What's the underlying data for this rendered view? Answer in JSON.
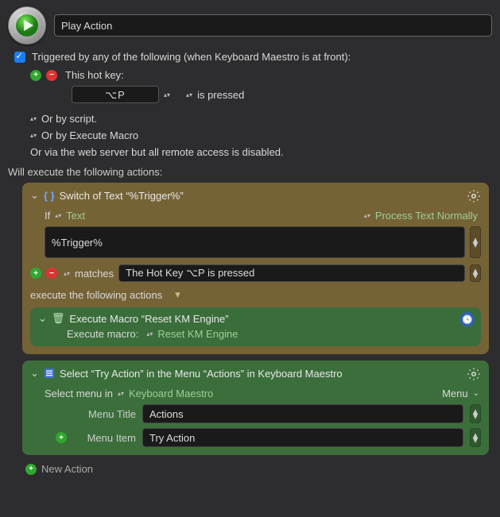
{
  "header": {
    "macro_name": "Play Action"
  },
  "trigger_section": {
    "checkbox_label": "Triggered by any of the following (when Keyboard Maestro is at front):",
    "hotkey_label": "This hot key:",
    "hotkey_value": "⌥P",
    "is_pressed_label": "is pressed",
    "or_script": "Or by script.",
    "or_exec_macro": "Or by Execute Macro",
    "or_webserver": "Or via the web server but all remote access is disabled."
  },
  "actions_heading": "Will execute the following actions:",
  "switch_panel": {
    "title": "Switch of Text “%Trigger%”",
    "if_label": "If",
    "text_label": "Text",
    "process_label": "Process Text Normally",
    "text_value": "%Trigger%",
    "matches_label": "matches",
    "match_value": "The Hot Key ⌥P is pressed",
    "execute_label": "execute the following actions",
    "nested": {
      "title": "Execute Macro “Reset KM Engine”",
      "exec_label": "Execute macro:",
      "macro_name": "Reset KM Engine"
    }
  },
  "select_panel": {
    "title": "Select “Try Action” in the Menu “Actions” in Keyboard Maestro",
    "select_menu_label": "Select menu in",
    "app_name": "Keyboard Maestro",
    "menu_popup_label": "Menu",
    "menu_title_label": "Menu Title",
    "menu_title_value": "Actions",
    "menu_item_label": "Menu Item",
    "menu_item_value": "Try Action"
  },
  "footer": {
    "new_action": "New Action"
  }
}
